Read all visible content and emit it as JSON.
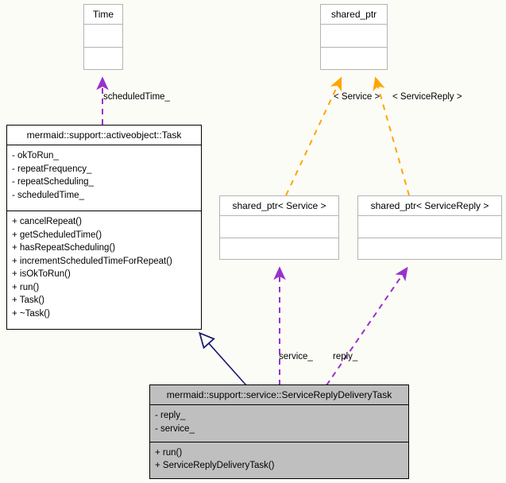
{
  "diagram": {
    "type": "uml-class-diagram",
    "background_color": "#fcfcf7",
    "nodes": [
      {
        "id": "time",
        "title": "Time",
        "style": "plain",
        "attributes": [],
        "operations": []
      },
      {
        "id": "shared_ptr",
        "title": "shared_ptr",
        "style": "plain",
        "attributes": [],
        "operations": []
      },
      {
        "id": "task",
        "title": "mermaid::support::activeobject::Task",
        "style": "thick",
        "attributes": [
          "- okToRun_",
          "- repeatFrequency_",
          "- repeatScheduling_",
          "- scheduledTime_"
        ],
        "operations": [
          "+ cancelRepeat()",
          "+ getScheduledTime()",
          "+ hasRepeatScheduling()",
          "+ incrementScheduledTimeForRepeat()",
          "+ isOkToRun()",
          "+ run()",
          "+ Task()",
          "+ ~Task()"
        ]
      },
      {
        "id": "sp_service",
        "title": "shared_ptr< Service >",
        "style": "plain",
        "attributes": [],
        "operations": []
      },
      {
        "id": "sp_servicereply",
        "title": "shared_ptr< ServiceReply >",
        "style": "plain",
        "attributes": [],
        "operations": []
      },
      {
        "id": "srdt",
        "title": "mermaid::support::service::ServiceReplyDeliveryTask",
        "style": "filled",
        "attributes": [
          "- reply_",
          "- service_"
        ],
        "operations": [
          "+ run()",
          "+ ServiceReplyDeliveryTask()"
        ]
      }
    ],
    "edges": [
      {
        "id": "task-uses-time",
        "from": "task",
        "to": "time",
        "kind": "usage",
        "color": "#9932cc",
        "label": "scheduledTime_"
      },
      {
        "id": "sp_service-binds-shared_ptr",
        "from": "sp_service",
        "to": "shared_ptr",
        "kind": "template-binding",
        "color": "#ffa500",
        "label": "< Service >"
      },
      {
        "id": "sp_servicereply-binds-shared_ptr",
        "from": "sp_servicereply",
        "to": "shared_ptr",
        "kind": "template-binding",
        "color": "#ffa500",
        "label": "< ServiceReply >"
      },
      {
        "id": "srdt-inherits-task",
        "from": "srdt",
        "to": "task",
        "kind": "inheritance",
        "color": "#191970",
        "label": ""
      },
      {
        "id": "srdt-uses-sp_service",
        "from": "srdt",
        "to": "sp_service",
        "kind": "usage",
        "color": "#9932cc",
        "label": "service_"
      },
      {
        "id": "srdt-uses-sp_servicereply",
        "from": "srdt",
        "to": "sp_servicereply",
        "kind": "usage",
        "color": "#9932cc",
        "label": "reply_"
      }
    ],
    "colors": {
      "usage_edge": "#9932cc",
      "template_edge": "#ffa500",
      "inheritance_edge": "#191970",
      "node_border_plain": "#b3b3b3",
      "node_border_strong": "#000000",
      "node_fill_highlight": "#bfbfbf",
      "node_fill_plain": "#ffffff"
    }
  }
}
